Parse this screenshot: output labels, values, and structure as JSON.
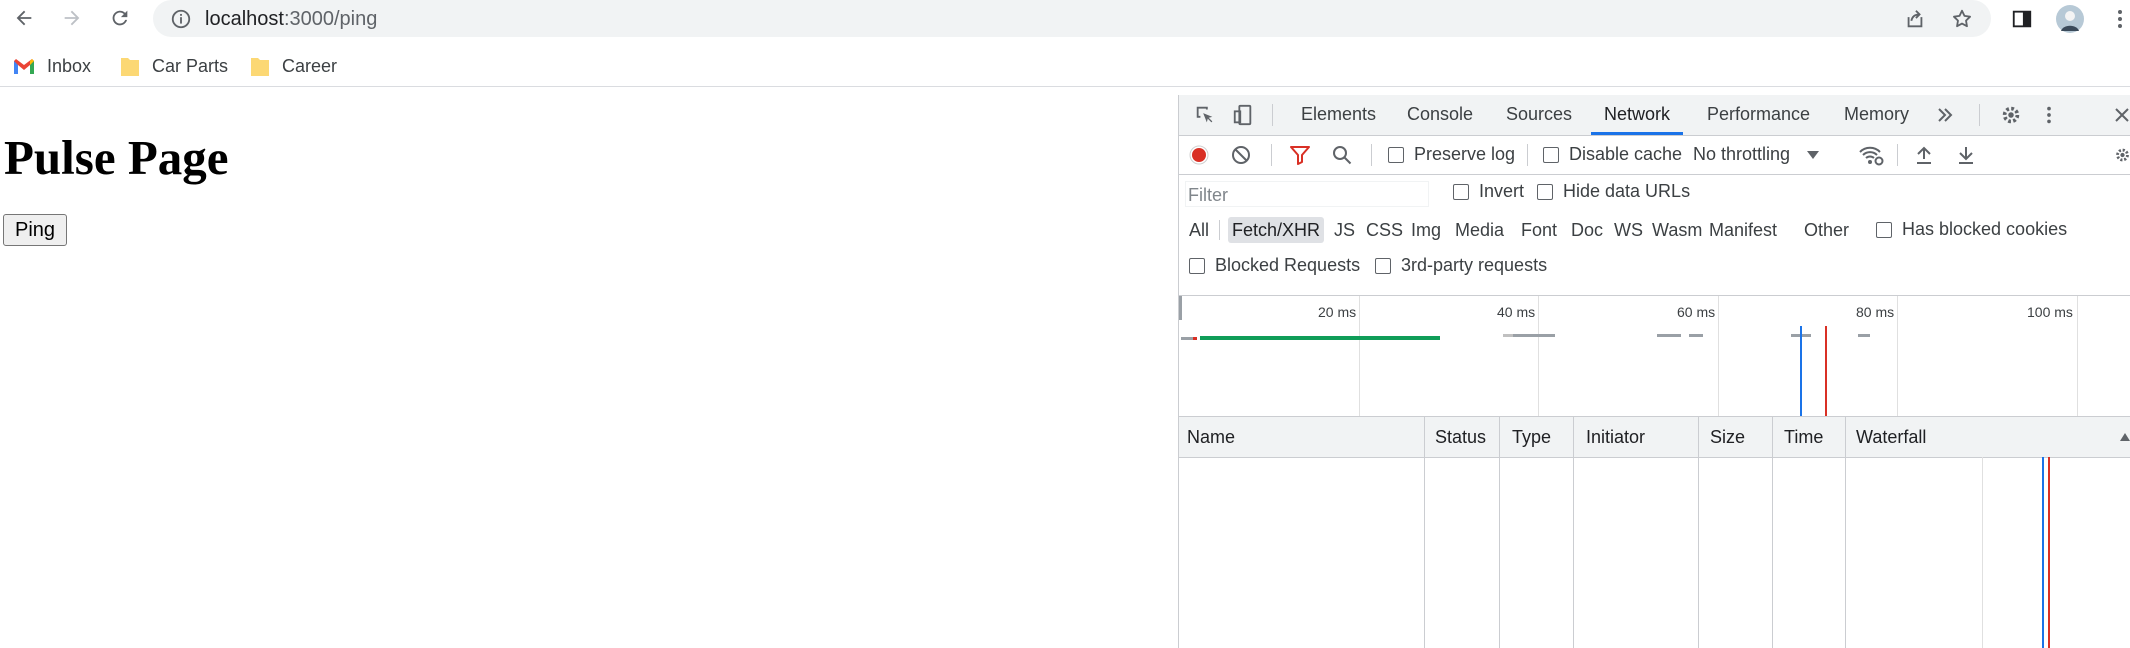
{
  "browser": {
    "url_host": "localhost",
    "url_path": ":3000/ping",
    "bookmarks": [
      {
        "label": "Inbox",
        "icon": "gmail-icon"
      },
      {
        "label": "Car Parts",
        "icon": "folder-icon"
      },
      {
        "label": "Career",
        "icon": "folder-icon"
      }
    ]
  },
  "page": {
    "title": "Pulse Page",
    "ping_label": "Ping"
  },
  "devtools": {
    "tabs": [
      "Elements",
      "Console",
      "Sources",
      "Network",
      "Performance",
      "Memory"
    ],
    "active_tab": "Network",
    "network": {
      "preserve_log": "Preserve log",
      "disable_cache": "Disable cache",
      "throttling": "No throttling",
      "filter_placeholder": "Filter",
      "invert": "Invert",
      "hide_data_urls": "Hide data URLs",
      "types": [
        "All",
        "Fetch/XHR",
        "JS",
        "CSS",
        "Img",
        "Media",
        "Font",
        "Doc",
        "WS",
        "Wasm",
        "Manifest",
        "Other"
      ],
      "active_type": "Fetch/XHR",
      "has_blocked_cookies": "Has blocked cookies",
      "blocked_requests": "Blocked Requests",
      "third_party": "3rd-party requests",
      "timeline_ticks": [
        "20 ms",
        "40 ms",
        "60 ms",
        "80 ms",
        "100 ms"
      ],
      "columns": [
        "Name",
        "Status",
        "Type",
        "Initiator",
        "Size",
        "Time",
        "Waterfall"
      ]
    }
  },
  "colors": {
    "record": "#d93025",
    "accent": "#1a73e8",
    "dom_line": "#1a73e8",
    "load_line": "#d93025",
    "bar_green": "#0f9d58"
  }
}
